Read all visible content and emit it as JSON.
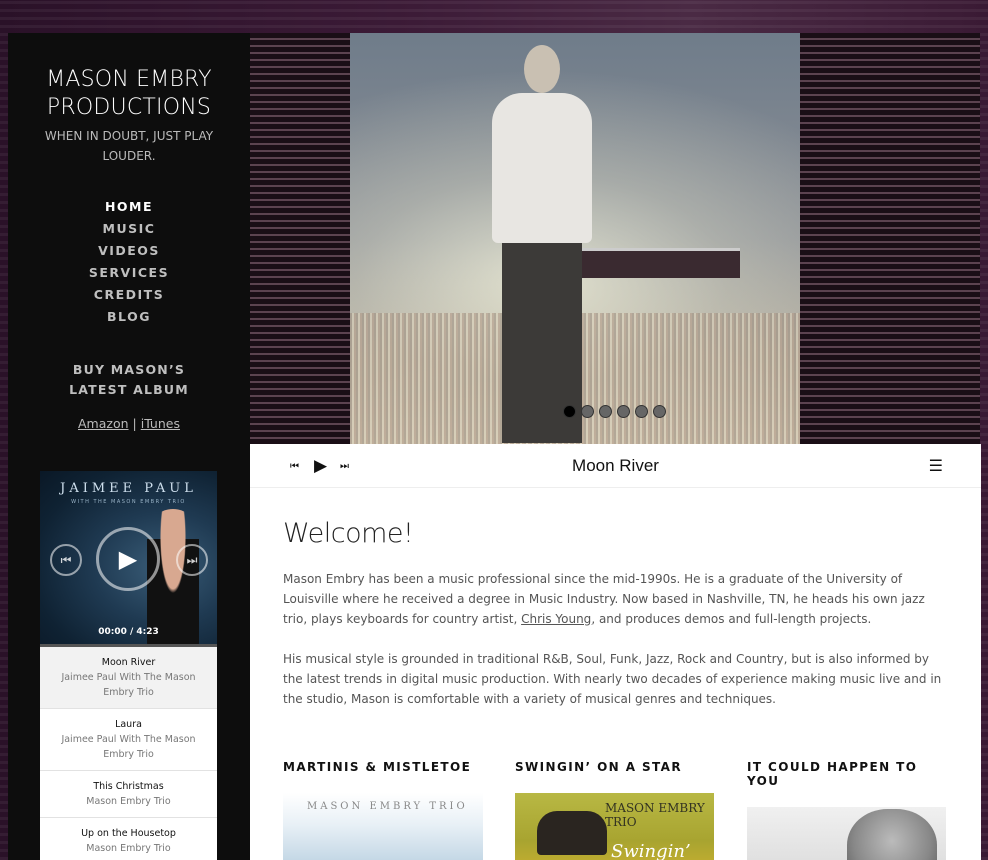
{
  "site": {
    "title": "MASON EMBRY PRODUCTIONS",
    "tagline": "WHEN IN DOUBT, JUST PLAY LOUDER."
  },
  "nav": {
    "items": [
      {
        "label": "HOME",
        "active": true
      },
      {
        "label": "MUSIC"
      },
      {
        "label": "VIDEOS"
      },
      {
        "label": "SERVICES"
      },
      {
        "label": "CREDITS"
      },
      {
        "label": "BLOG"
      }
    ]
  },
  "buy": {
    "heading": "BUY MASON’S LATEST ALBUM",
    "amazon": "Amazon",
    "separator": "|",
    "itunes": "iTunes"
  },
  "sidebar_player": {
    "cover_name": "JAIMEE PAUL",
    "cover_sub": "WITH THE MASON EMBRY TRIO",
    "time": "00:00 / 4:23",
    "tracks": [
      {
        "title": "Moon River",
        "artist": "Jaimee Paul With The Mason Embry Trio"
      },
      {
        "title": "Laura",
        "artist": "Jaimee Paul With The Mason Embry Trio"
      },
      {
        "title": "This Christmas",
        "artist": "Mason Embry Trio"
      },
      {
        "title": "Up on the Housetop",
        "artist": "Mason Embry Trio"
      }
    ]
  },
  "hero": {
    "slides": 6,
    "active_slide": 1
  },
  "audio_bar": {
    "title": "Moon River"
  },
  "content": {
    "heading": "Welcome!",
    "para1_before": "Mason Embry has been a music professional since the mid-1990s. He is a graduate of the University of Louisville where he received a degree in Music Industry. Now based in Nashville, TN, he heads his own jazz trio, plays keyboards for country artist, ",
    "para1_link": "Chris Young",
    "para1_after": ", and produces demos and full-length projects.",
    "para2": "His musical style is grounded in traditional R&B, Soul, Funk, Jazz, Rock and Country, but is also informed by the latest trends in digital music production. With nearly two decades of experience making music live and in the studio, Mason is comfortable with a variety of musical genres and techniques."
  },
  "albums": [
    {
      "title": "MARTINIS & MISTLETOE",
      "art_text": "MASON EMBRY TRIO"
    },
    {
      "title": "SWINGIN’ ON A STAR",
      "art_text": "MASON EMBRY TRIO",
      "art_script": "Swingin’"
    },
    {
      "title": "IT COULD HAPPEN TO YOU"
    }
  ],
  "icons": {
    "prev": "skip-back-icon",
    "play": "play-icon",
    "next": "skip-forward-icon",
    "playlist": "playlist-icon"
  }
}
